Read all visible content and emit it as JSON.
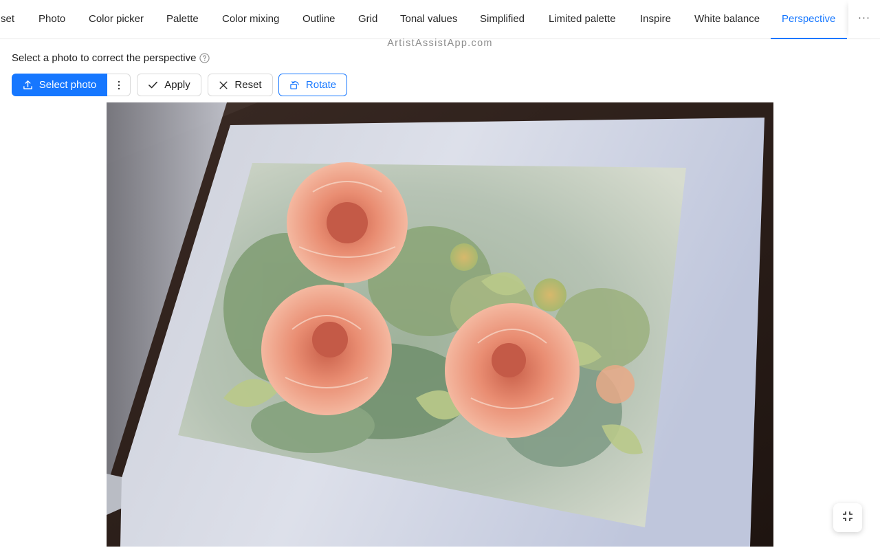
{
  "tabs": [
    {
      "label": "set",
      "name": "tab-preset"
    },
    {
      "label": "Photo",
      "name": "tab-photo"
    },
    {
      "label": "Color picker",
      "name": "tab-color-picker"
    },
    {
      "label": "Palette",
      "name": "tab-palette"
    },
    {
      "label": "Color mixing",
      "name": "tab-color-mixing"
    },
    {
      "label": "Outline",
      "name": "tab-outline"
    },
    {
      "label": "Grid",
      "name": "tab-grid"
    },
    {
      "label": "Tonal values",
      "name": "tab-tonal-values"
    },
    {
      "label": "Simplified",
      "name": "tab-simplified"
    },
    {
      "label": "Limited palette",
      "name": "tab-limited-palette"
    },
    {
      "label": "Inspire",
      "name": "tab-inspire"
    },
    {
      "label": "White balance",
      "name": "tab-white-balance"
    },
    {
      "label": "Perspective",
      "name": "tab-perspective",
      "active": true
    }
  ],
  "more_label": "···",
  "watermark": "ArtistAssistApp.com",
  "instruction": "Select a photo to correct the perspective",
  "toolbar": {
    "select_photo": "Select photo",
    "apply": "Apply",
    "reset": "Reset",
    "rotate": "Rotate"
  },
  "colors": {
    "primary": "#1677ff",
    "border": "#d9d9d9"
  },
  "icons": {
    "help": "question-circle-icon",
    "upload": "upload-icon",
    "more": "more-vertical-icon",
    "apply": "check-icon",
    "reset": "close-icon",
    "rotate": "rotate-icon",
    "fullscreen_exit": "fullscreen-exit-icon"
  },
  "photo": {
    "subject": "watercolor painting of orange dahlias on white paper, photographed at an angle on a dark wooden table"
  }
}
